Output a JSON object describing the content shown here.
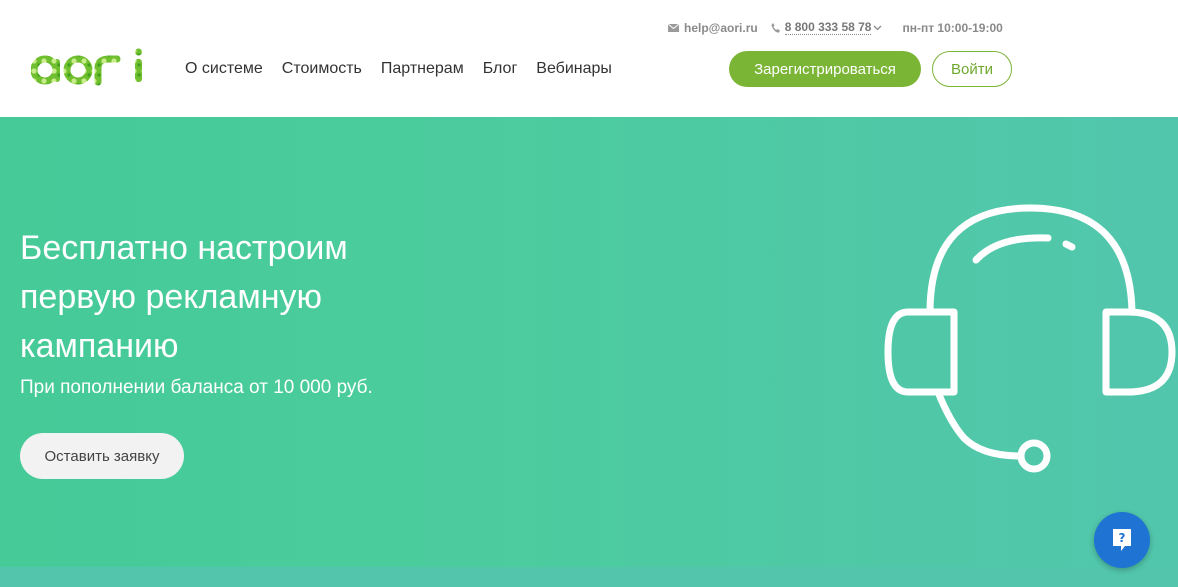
{
  "header": {
    "logo_text": "aori",
    "email": "help@aori.ru",
    "phone": "8 800 333 58 78",
    "hours": "пн-пт 10:00-19:00",
    "nav": [
      {
        "label": "О системе"
      },
      {
        "label": "Стоимость"
      },
      {
        "label": "Партнерам"
      },
      {
        "label": "Блог"
      },
      {
        "label": "Вебинары"
      }
    ],
    "register_label": "Зарегистрироваться",
    "login_label": "Войти"
  },
  "hero": {
    "title": "Бесплатно настроим первую рекламную кампанию",
    "subtitle": "При пополнении баланса от 10 000 руб.",
    "cta_label": "Оставить заявку"
  },
  "colors": {
    "brand_green": "#7bb535",
    "hero_bg": "#4ccc9e",
    "help_blue": "#1f74d3"
  },
  "icons": [
    "logo",
    "mail-icon",
    "phone-icon",
    "chevron-down-icon",
    "headset-icon",
    "help-icon"
  ]
}
